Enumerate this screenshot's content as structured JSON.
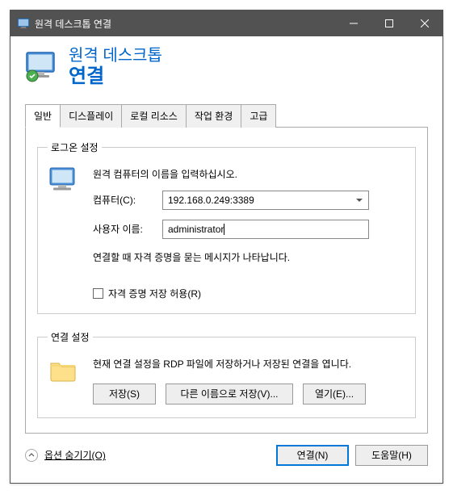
{
  "titlebar": {
    "title": "원격 데스크톱 연결"
  },
  "banner": {
    "line1": "원격 데스크톱",
    "line2": "연결"
  },
  "tabs": {
    "items": [
      {
        "label": "일반"
      },
      {
        "label": "디스플레이"
      },
      {
        "label": "로컬 리소스"
      },
      {
        "label": "작업 환경"
      },
      {
        "label": "고급"
      }
    ]
  },
  "logon": {
    "legend": "로그온 설정",
    "instruction": "원격 컴퓨터의 이름을 입력하십시오.",
    "computer_label": "컴퓨터(C):",
    "computer_value": "192.168.0.249:3389",
    "user_label": "사용자 이름:",
    "user_value": "administrator",
    "note": "연결할 때 자격 증명을 묻는 메시지가 나타납니다.",
    "save_cred_label": "자격 증명 저장 허용(R)"
  },
  "conn": {
    "legend": "연결 설정",
    "description": "현재 연결 설정을 RDP 파일에 저장하거나 저장된 연결을 엽니다.",
    "save": "저장(S)",
    "save_as": "다른 이름으로 저장(V)...",
    "open": "열기(E)..."
  },
  "footer": {
    "options": "옵션 숨기기(O)",
    "connect": "연결(N)",
    "help": "도움말(H)"
  }
}
